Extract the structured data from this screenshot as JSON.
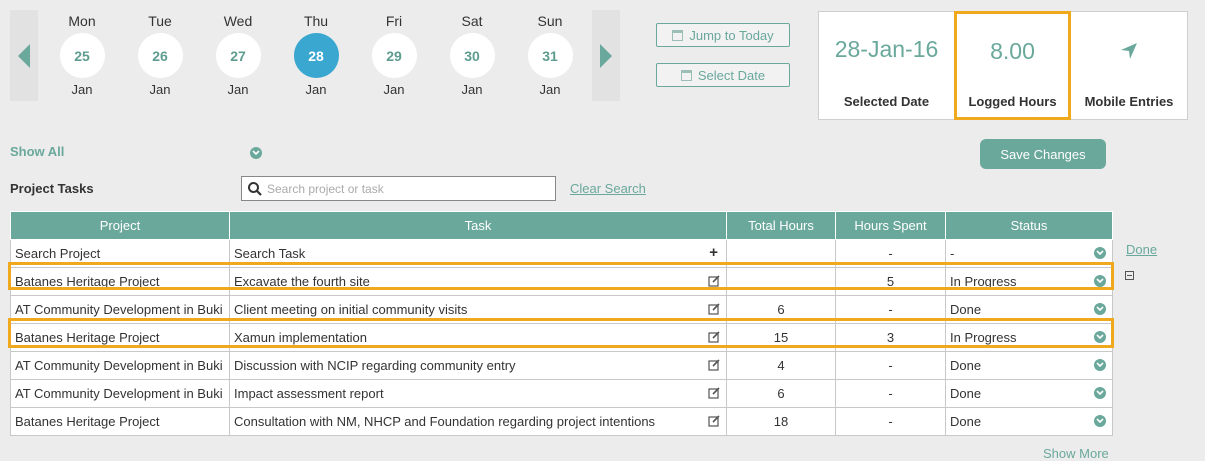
{
  "week": {
    "days": [
      {
        "dow": "Mon",
        "date": "25",
        "month": "Jan"
      },
      {
        "dow": "Tue",
        "date": "26",
        "month": "Jan"
      },
      {
        "dow": "Wed",
        "date": "27",
        "month": "Jan"
      },
      {
        "dow": "Thu",
        "date": "28",
        "month": "Jan"
      },
      {
        "dow": "Fri",
        "date": "29",
        "month": "Jan"
      },
      {
        "dow": "Sat",
        "date": "30",
        "month": "Jan"
      },
      {
        "dow": "Sun",
        "date": "31",
        "month": "Jan"
      }
    ],
    "active_index": 3
  },
  "buttons": {
    "jump_today": "Jump to Today",
    "select_date": "Select Date",
    "save_changes": "Save Changes"
  },
  "summary": {
    "selected_date_value": "28-Jan-16",
    "selected_date_label": "Selected Date",
    "logged_hours_value": "8.00",
    "logged_hours_label": "Logged Hours",
    "mobile_entries_label": "Mobile Entries"
  },
  "filters": {
    "show_all": "Show All",
    "section_title": "Project Tasks",
    "search_placeholder": "Search project or task",
    "clear_search": "Clear Search"
  },
  "table": {
    "headers": [
      "Project",
      "Task",
      "Total Hours",
      "Hours Spent",
      "Status"
    ],
    "search_row": {
      "project": "Search Project",
      "task": "Search Task",
      "total": "",
      "spent": "-",
      "status": "-"
    },
    "rows": [
      {
        "project": "Batanes Heritage Project",
        "task": "Excavate the fourth site",
        "total": "",
        "spent": "5",
        "status": "In Progress"
      },
      {
        "project": "AT Community Development in Buki",
        "task": "Client meeting on initial community visits",
        "total": "6",
        "spent": "-",
        "status": "Done"
      },
      {
        "project": "Batanes Heritage Project",
        "task": "Xamun implementation",
        "total": "15",
        "spent": "3",
        "status": "In Progress"
      },
      {
        "project": "AT Community Development in Buki",
        "task": "Discussion with NCIP regarding community entry",
        "total": "4",
        "spent": "-",
        "status": "Done"
      },
      {
        "project": "AT Community Development in Buki",
        "task": "Impact assessment report",
        "total": "6",
        "spent": "-",
        "status": "Done"
      },
      {
        "project": "Batanes Heritage Project",
        "task": "Consultation with NM, NHCP and Foundation regarding project intentions",
        "total": "18",
        "spent": "-",
        "status": "Done"
      }
    ]
  },
  "side": {
    "done_link": "Done",
    "show_more": "Show More"
  },
  "colors": {
    "accent": "#6aa89b",
    "active_day": "#3aa7d0",
    "highlight": "#f0a91c"
  }
}
